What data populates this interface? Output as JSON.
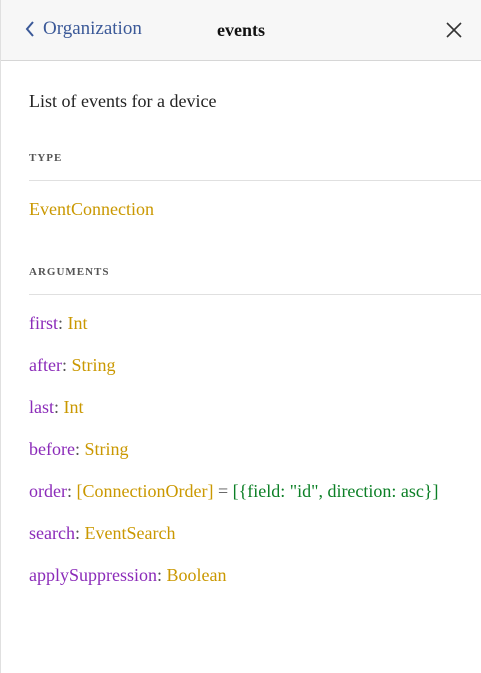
{
  "header": {
    "back_label": "Organization",
    "title": "events"
  },
  "description": "List of events for a device",
  "type_section": {
    "heading": "TYPE",
    "type_name": "EventConnection"
  },
  "arguments_section": {
    "heading": "ARGUMENTS",
    "args": [
      {
        "name": "first",
        "type": "Int"
      },
      {
        "name": "after",
        "type": "String"
      },
      {
        "name": "last",
        "type": "Int"
      },
      {
        "name": "before",
        "type": "String"
      },
      {
        "name": "order",
        "type_open": "[",
        "type": "ConnectionOrder",
        "type_close": "]",
        "equals": " = ",
        "default": "[{field: \"id\", direction: asc}]"
      },
      {
        "name": "search",
        "type": "EventSearch"
      },
      {
        "name": "applySuppression",
        "type": "Boolean"
      }
    ]
  },
  "colors": {
    "arg_name": "#8b2bb9",
    "type": "#ca9800",
    "default_value": "#0b7f25",
    "back_link": "#3b5998"
  },
  "icons": {
    "back": "chevron-left-icon",
    "close": "close-icon"
  }
}
